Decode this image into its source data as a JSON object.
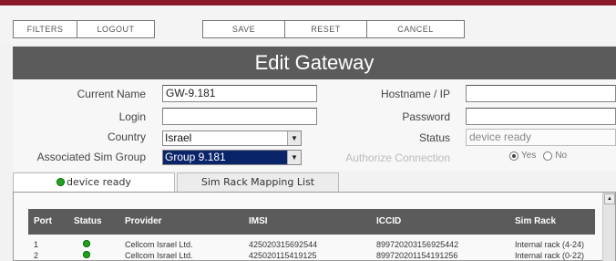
{
  "toolbar": {
    "filters": "FILTERS",
    "logout": "LOGOUT",
    "save": "SAVE",
    "reset": "RESET",
    "cancel": "CANCEL"
  },
  "page_title": "Edit Gateway",
  "form": {
    "current_name_label": "Current Name",
    "current_name_value": "GW-9.181",
    "login_label": "Login",
    "login_value": "",
    "country_label": "Country",
    "country_value": "Israel",
    "sim_group_label": "Associated Sim Group",
    "sim_group_value": "Group 9.181",
    "hostname_label": "Hostname / IP",
    "hostname_value": "",
    "password_label": "Password",
    "password_value": "",
    "status_label": "Status",
    "status_value": "device ready",
    "authorize_label": "Authorize Connection",
    "authorize_yes": "Yes",
    "authorize_no": "No",
    "authorize_selected": "Yes"
  },
  "tabs": [
    {
      "label": "device ready",
      "status_color": "#1fa31f"
    },
    {
      "label": "Sim Rack Mapping List"
    }
  ],
  "table": {
    "headers": [
      "Port",
      "Status",
      "Provider",
      "IMSI",
      "ICCID",
      "Sim Rack"
    ],
    "rows": [
      {
        "port": "1",
        "status": "green",
        "provider": "Cellcom Israel Ltd.",
        "imsi": "425020315692544",
        "iccid": "899720203156925442",
        "sim_rack": "Internal rack (4-24)"
      },
      {
        "port": "2",
        "status": "green",
        "provider": "Cellcom Israel Ltd.",
        "imsi": "425020115419125",
        "iccid": "899720201154191256",
        "sim_rack": "Internal rack (0-22)"
      }
    ]
  },
  "colors": {
    "accent_red": "#8a1a2a",
    "header_gray": "#5b5b5b",
    "status_green": "#1fa31f",
    "select_highlight": "#0a246a"
  }
}
